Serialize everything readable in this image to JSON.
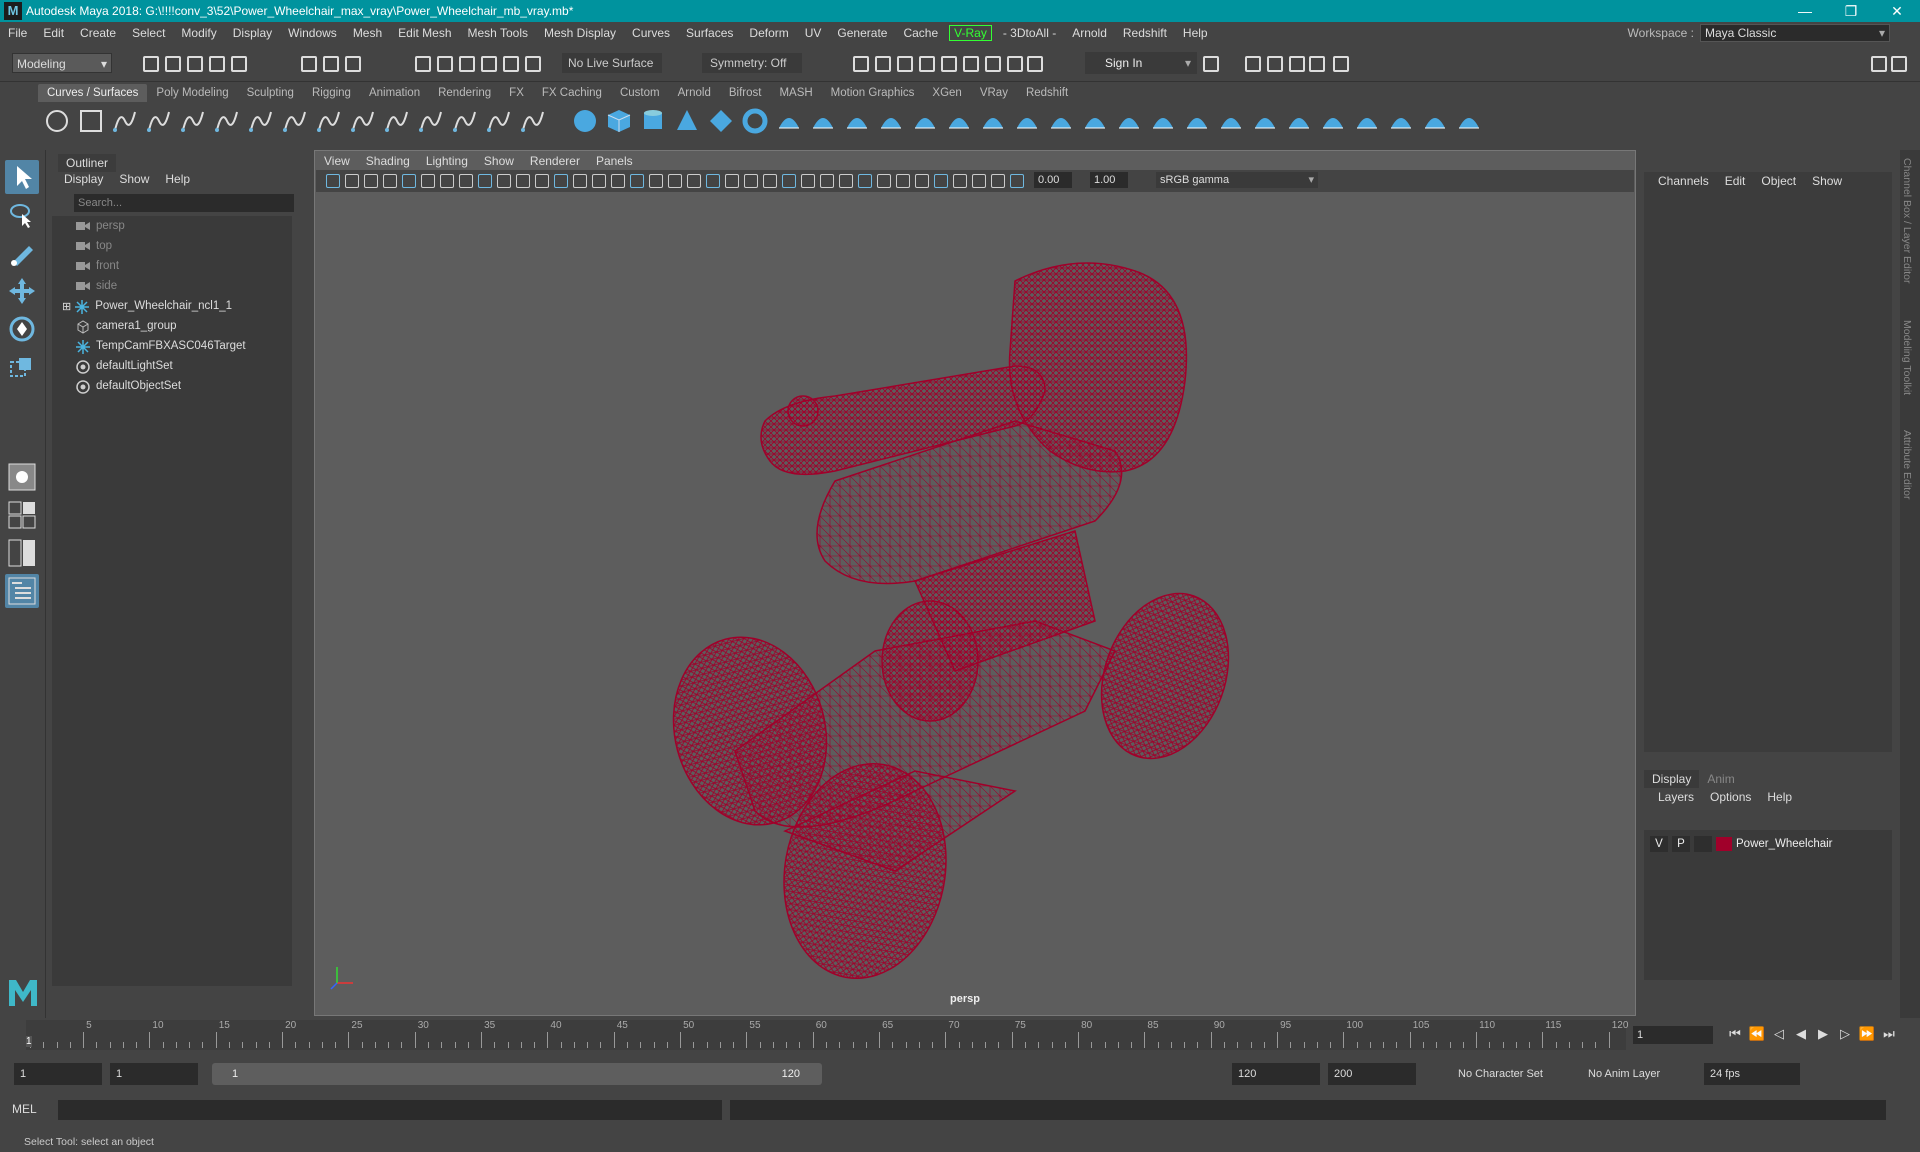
{
  "titlebar": {
    "title": "Autodesk Maya 2018: G:\\!!!!conv_3\\52\\Power_Wheelchair_max_vray\\Power_Wheelchair_mb_vray.mb*",
    "logo": "M",
    "minimize": "—",
    "restore": "❐",
    "close": "✕"
  },
  "menubar": {
    "items": [
      "File",
      "Edit",
      "Create",
      "Select",
      "Modify",
      "Display",
      "Windows",
      "Mesh",
      "Edit Mesh",
      "Mesh Tools",
      "Mesh Display",
      "Curves",
      "Surfaces",
      "Deform",
      "UV",
      "Generate",
      "Cache"
    ],
    "vray": "V-Ray",
    "items2": [
      "- 3DtoAll -",
      "Arnold",
      "Redshift",
      "Help"
    ]
  },
  "workspace": {
    "label": "Workspace :",
    "value": "Maya Classic"
  },
  "statusline": {
    "mode": "Modeling",
    "live_surface": "No Live Surface",
    "symmetry": "Symmetry: Off",
    "sign_in": "Sign In"
  },
  "shelf": {
    "tabs": [
      "Curves / Surfaces",
      "Poly Modeling",
      "Sculpting",
      "Rigging",
      "Animation",
      "Rendering",
      "FX",
      "FX Caching",
      "Custom",
      "Arnold",
      "Bifrost",
      "MASH",
      "Motion Graphics",
      "XGen",
      "VRay",
      "Redshift"
    ],
    "active_tab": "Curves / Surfaces"
  },
  "outliner": {
    "title": "Outliner",
    "menu": [
      "Display",
      "Show",
      "Help"
    ],
    "search_placeholder": "Search...",
    "items": [
      {
        "label": "persp",
        "icon": "camera-icon",
        "dim": true
      },
      {
        "label": "top",
        "icon": "camera-icon",
        "dim": true
      },
      {
        "label": "front",
        "icon": "camera-icon",
        "dim": true
      },
      {
        "label": "side",
        "icon": "camera-icon",
        "dim": true
      },
      {
        "label": "Power_Wheelchair_ncl1_1",
        "icon": "transform-icon",
        "dim": false,
        "expandable": true
      },
      {
        "label": "camera1_group",
        "icon": "group-icon",
        "dim": false
      },
      {
        "label": "TempCamFBXASC046Target",
        "icon": "transform-icon",
        "dim": false
      },
      {
        "label": "defaultLightSet",
        "icon": "set-icon",
        "dim": false
      },
      {
        "label": "defaultObjectSet",
        "icon": "set-icon",
        "dim": false
      }
    ]
  },
  "viewport": {
    "menu": [
      "View",
      "Shading",
      "Lighting",
      "Show",
      "Renderer",
      "Panels"
    ],
    "exposure": "0.00",
    "gamma": "1.00",
    "color_space": "sRGB gamma",
    "camera": "persp",
    "wire_color": "#a0002a"
  },
  "channelbox": {
    "menu": [
      "Channels",
      "Edit",
      "Object",
      "Show"
    ]
  },
  "layers": {
    "tabs": [
      "Display",
      "Anim"
    ],
    "active_tab": "Display",
    "menu": [
      "Layers",
      "Options",
      "Help"
    ],
    "rows": [
      {
        "v": "V",
        "p": "P",
        "name": "Power_Wheelchair",
        "color": "#a0002a"
      }
    ]
  },
  "sidetabs": [
    "Channel Box / Layer Editor",
    "Modeling Toolkit",
    "Attribute Editor"
  ],
  "timeslider": {
    "ticks": [
      "5",
      "10",
      "15",
      "20",
      "25",
      "30",
      "35",
      "40",
      "45",
      "50",
      "55",
      "60",
      "65",
      "70",
      "75",
      "80",
      "85",
      "90",
      "95",
      "100",
      "105",
      "110",
      "115",
      "120"
    ],
    "start_marker": "1",
    "current_frame": "1"
  },
  "range": {
    "start": "1",
    "playback_start": "1",
    "slider_start": "1",
    "slider_end": "120",
    "playback_end": "120",
    "end": "200",
    "character_set": "No Character Set",
    "anim_layer": "No Anim Layer",
    "fps": "24 fps"
  },
  "cmdline": {
    "label": "MEL"
  },
  "helpline": {
    "text": "Select Tool: select an object"
  }
}
